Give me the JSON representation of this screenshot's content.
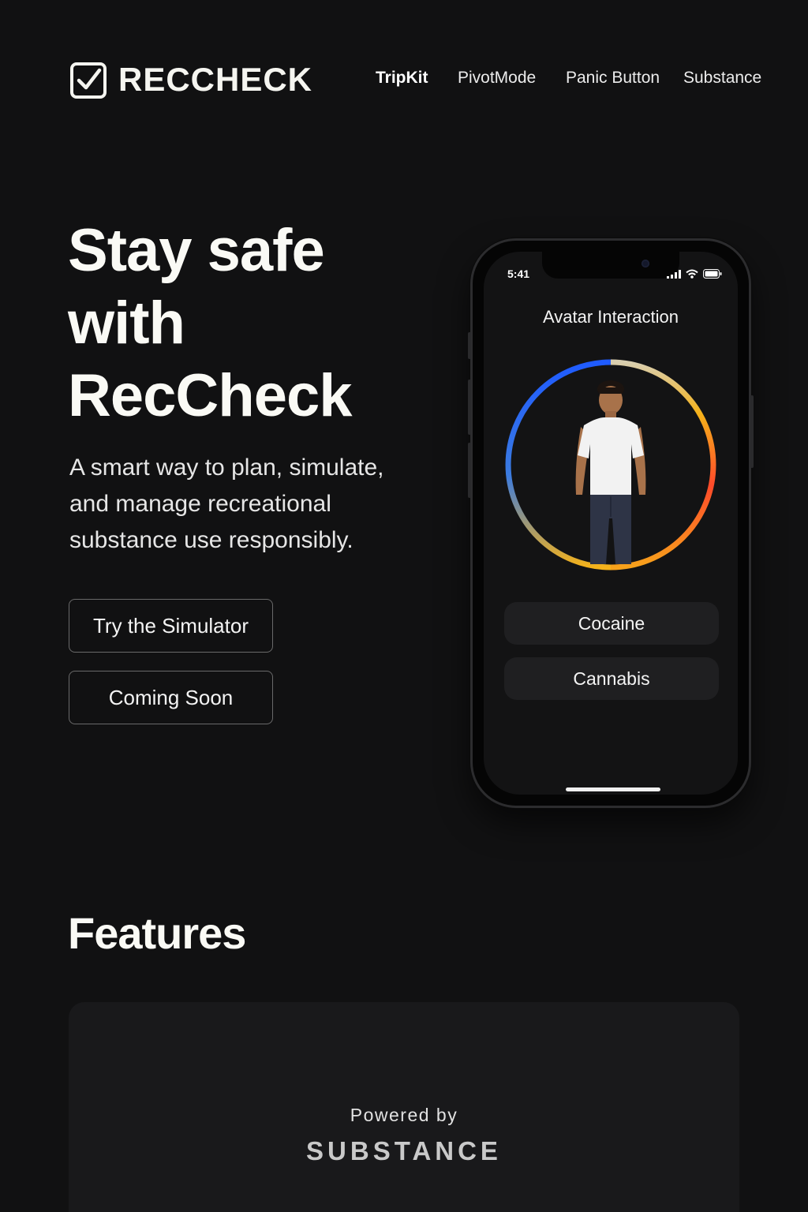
{
  "brand": {
    "name": "RECCHECK",
    "logo_icon": "checkbox-icon"
  },
  "nav": {
    "items": [
      {
        "label": "TripKit",
        "active": true
      },
      {
        "label": "PivotMode",
        "active": false
      },
      {
        "label": "Panic Button",
        "active": false
      },
      {
        "label": "Substance",
        "active": false
      }
    ]
  },
  "hero": {
    "title_line1": "Stay safe",
    "title_line2": "with",
    "title_line3": "RecCheck",
    "subtitle": "A smart way to plan, simulate, and manage recreational substance use responsibly.",
    "primary_button": "Try the Simulator",
    "secondary_button": "Coming Soon"
  },
  "phone": {
    "status_time": "5:41",
    "status_icons": [
      "signal-icon",
      "wifi-icon",
      "battery-icon"
    ],
    "screen_title": "Avatar Interaction",
    "avatar_icon": "person-avatar",
    "substances": [
      "Cocaine",
      "Cannabis"
    ]
  },
  "features": {
    "title": "Features",
    "powered_by": "Powered  by",
    "powered_brand": "SUBSTANCE"
  },
  "colors": {
    "background": "#111112",
    "card": "#19191b",
    "ring_blue": "#1f5bff",
    "ring_yellow": "#f5b21a",
    "ring_red": "#ff4a2a"
  }
}
